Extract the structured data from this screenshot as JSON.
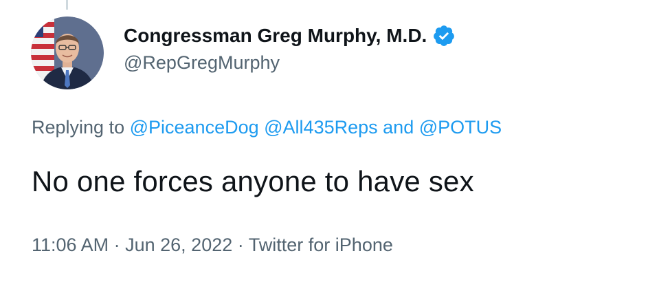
{
  "author": {
    "display_name": "Congressman Greg Murphy, M.D.",
    "handle": "@RepGregMurphy",
    "verified": true,
    "avatar_icon": "avatar-portrait-icon",
    "verified_icon": "verified-badge-icon"
  },
  "reply": {
    "prefix": "Replying to",
    "mention_1": "@PiceanceDog",
    "mention_2": "@All435Reps",
    "conjunction": "and",
    "mention_3": "@POTUS"
  },
  "tweet": {
    "text": "No one forces anyone to have sex"
  },
  "meta": {
    "time": "11:06 AM",
    "separator_1": "·",
    "date": "Jun 26, 2022",
    "separator_2": "·",
    "source": "Twitter for iPhone"
  },
  "colors": {
    "accent": "#1d9bf0",
    "secondary_text": "#536471",
    "primary_text": "#0f1419",
    "background": "#ffffff"
  }
}
